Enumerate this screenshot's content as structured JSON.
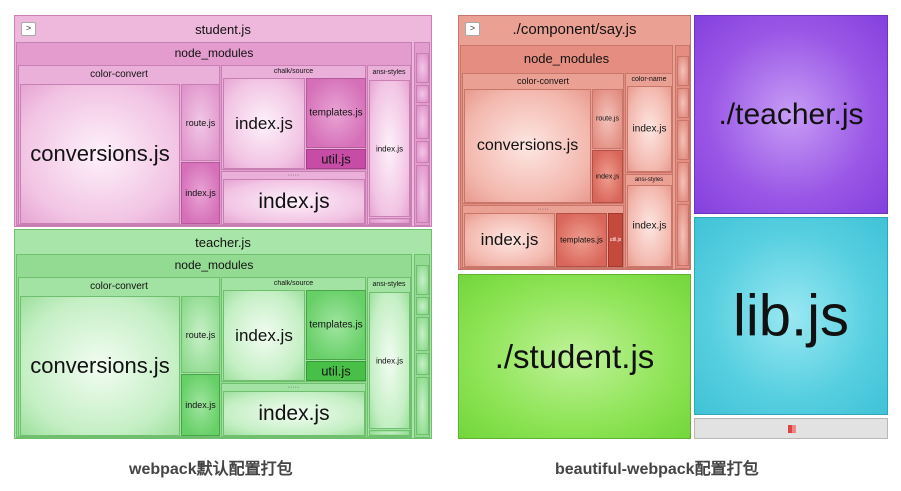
{
  "left_treemap": {
    "toggle_label": ">",
    "student": {
      "root": "student.js",
      "node_modules": "node_modules",
      "color_convert": "color-convert",
      "conversions": "conversions.js",
      "route": "route.js",
      "cc_index": "index.js",
      "chalk_source": "chalk/source",
      "chalk_index": "index.js",
      "templates": "templates.js",
      "util": "util.js",
      "color_name_index": "index.js",
      "ansi_styles": "ansi-styles",
      "ansi_index": "index.js"
    },
    "teacher": {
      "root": "teacher.js",
      "node_modules": "node_modules",
      "color_convert": "color-convert",
      "conversions": "conversions.js",
      "route": "route.js",
      "cc_index": "index.js",
      "chalk_source": "chalk/source",
      "chalk_index": "index.js",
      "templates": "templates.js",
      "util": "util.js",
      "color_name_index": "index.js",
      "ansi_styles": "ansi-styles",
      "ansi_index": "index.js"
    }
  },
  "right_treemap": {
    "toggle_label": ">",
    "say": {
      "root": "./component/say.js",
      "node_modules": "node_modules",
      "color_convert": "color-convert",
      "conversions": "conversions.js",
      "route": "route.js",
      "cc_index": "index.js",
      "color_name": "color-name",
      "color_name_index": "index.js",
      "ansi_styles": "ansi-styles",
      "ansi_index": "index.js",
      "chalk_index": "index.js",
      "templates": "templates.js",
      "util": "util.js"
    },
    "teacher": "./teacher.js",
    "lib": "lib.js",
    "student": "./student.js"
  },
  "captions": {
    "left": "webpack默认配置打包",
    "right": "beautiful-webpack配置打包"
  },
  "colors": {
    "pink": "#e39ccd",
    "green": "#93db93",
    "salmon": "#e48d80",
    "purple": "#8f47e2",
    "cyan": "#4fc9d9",
    "lime": "#7ede44"
  }
}
